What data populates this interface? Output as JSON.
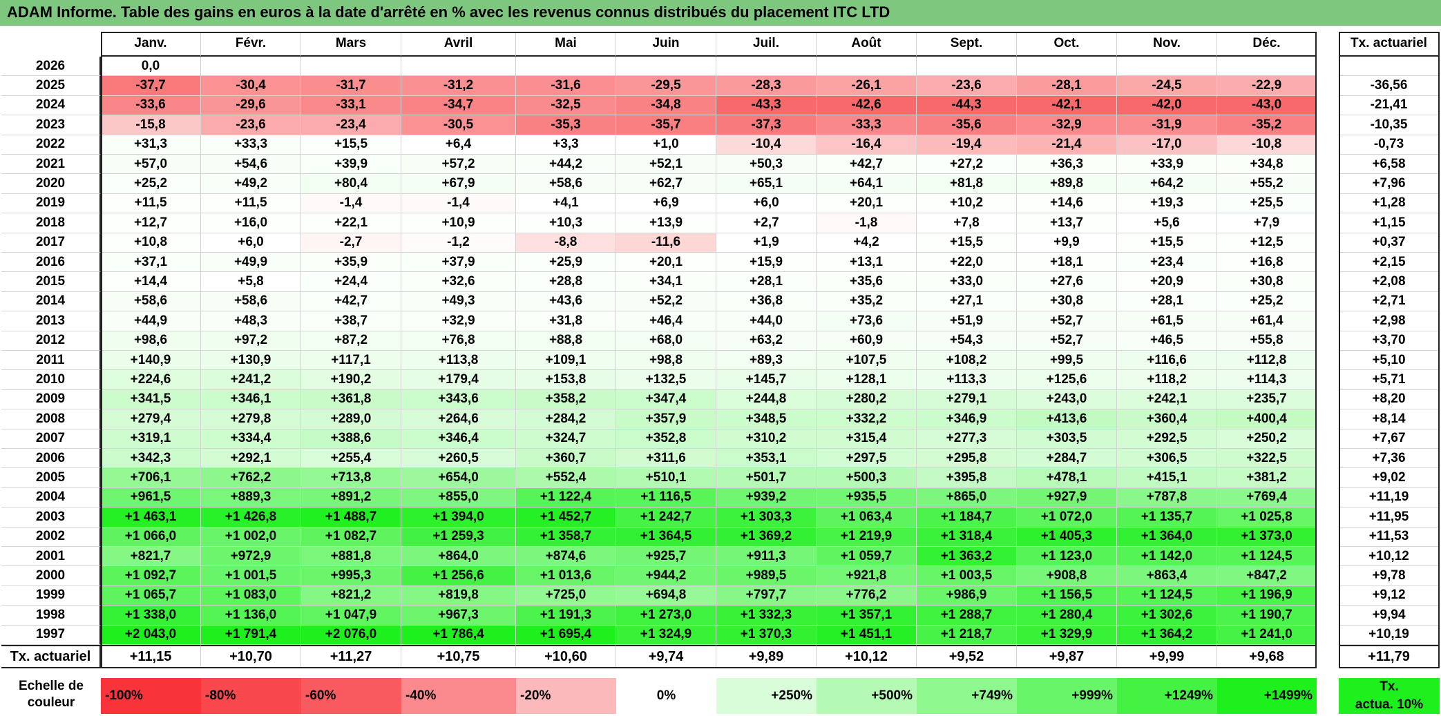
{
  "title": "ADAM Informe. Table des gains en euros à la date d'arrêté en % avec les revenus connus distribués du placement ITC LTD",
  "months": [
    "Janv.",
    "Févr.",
    "Mars",
    "Avril",
    "Mai",
    "Juin",
    "Juil.",
    "Août",
    "Sept.",
    "Oct.",
    "Nov.",
    "Déc."
  ],
  "rate_header": "Tx. actuariel",
  "rows": [
    {
      "year": "2026",
      "cells": [
        "0,0",
        "",
        "",
        "",
        "",
        "",
        "",
        "",
        "",
        "",
        "",
        ""
      ],
      "rate": ""
    },
    {
      "year": "2025",
      "cells": [
        "-37,7",
        "-30,4",
        "-31,7",
        "-31,2",
        "-31,6",
        "-29,5",
        "-28,3",
        "-26,1",
        "-23,6",
        "-28,1",
        "-24,5",
        "-22,9"
      ],
      "rate": "-36,56"
    },
    {
      "year": "2024",
      "cells": [
        "-33,6",
        "-29,6",
        "-33,1",
        "-34,7",
        "-32,5",
        "-34,8",
        "-43,3",
        "-42,6",
        "-44,3",
        "-42,1",
        "-42,0",
        "-43,0"
      ],
      "rate": "-21,41"
    },
    {
      "year": "2023",
      "cells": [
        "-15,8",
        "-23,6",
        "-23,4",
        "-30,5",
        "-35,3",
        "-35,7",
        "-37,3",
        "-33,3",
        "-35,6",
        "-32,9",
        "-31,9",
        "-35,2"
      ],
      "rate": "-10,35"
    },
    {
      "year": "2022",
      "cells": [
        "+31,3",
        "+33,3",
        "+15,5",
        "+6,4",
        "+3,3",
        "+1,0",
        "-10,4",
        "-16,4",
        "-19,4",
        "-21,4",
        "-17,0",
        "-10,8"
      ],
      "rate": "-0,73"
    },
    {
      "year": "2021",
      "cells": [
        "+57,0",
        "+54,6",
        "+39,9",
        "+57,2",
        "+44,2",
        "+52,1",
        "+50,3",
        "+42,7",
        "+27,2",
        "+36,3",
        "+33,9",
        "+34,8"
      ],
      "rate": "+6,58"
    },
    {
      "year": "2020",
      "cells": [
        "+25,2",
        "+49,2",
        "+80,4",
        "+67,9",
        "+58,6",
        "+62,7",
        "+65,1",
        "+64,1",
        "+81,8",
        "+89,8",
        "+64,2",
        "+55,2"
      ],
      "rate": "+7,96"
    },
    {
      "year": "2019",
      "cells": [
        "+11,5",
        "+11,5",
        "-1,4",
        "-1,4",
        "+4,1",
        "+6,9",
        "+6,0",
        "+20,1",
        "+10,2",
        "+14,6",
        "+19,3",
        "+25,5"
      ],
      "rate": "+1,28"
    },
    {
      "year": "2018",
      "cells": [
        "+12,7",
        "+16,0",
        "+22,1",
        "+10,9",
        "+10,3",
        "+13,9",
        "+2,7",
        "-1,8",
        "+7,8",
        "+13,7",
        "+5,6",
        "+7,9"
      ],
      "rate": "+1,15"
    },
    {
      "year": "2017",
      "cells": [
        "+10,8",
        "+6,0",
        "-2,7",
        "-1,2",
        "-8,8",
        "-11,6",
        "+1,9",
        "+4,2",
        "+15,5",
        "+9,9",
        "+15,5",
        "+12,5"
      ],
      "rate": "+0,37"
    },
    {
      "year": "2016",
      "cells": [
        "+37,1",
        "+49,9",
        "+35,9",
        "+37,9",
        "+25,9",
        "+20,1",
        "+15,9",
        "+13,1",
        "+22,0",
        "+18,1",
        "+23,4",
        "+16,8"
      ],
      "rate": "+2,15"
    },
    {
      "year": "2015",
      "cells": [
        "+14,4",
        "+5,8",
        "+24,4",
        "+32,6",
        "+28,8",
        "+34,1",
        "+28,1",
        "+35,6",
        "+33,0",
        "+27,6",
        "+20,9",
        "+30,8"
      ],
      "rate": "+2,08"
    },
    {
      "year": "2014",
      "cells": [
        "+58,6",
        "+58,6",
        "+42,7",
        "+49,3",
        "+43,6",
        "+52,2",
        "+36,8",
        "+35,2",
        "+27,1",
        "+30,8",
        "+28,1",
        "+25,2"
      ],
      "rate": "+2,71"
    },
    {
      "year": "2013",
      "cells": [
        "+44,9",
        "+48,3",
        "+38,7",
        "+32,9",
        "+31,8",
        "+46,4",
        "+44,0",
        "+73,6",
        "+51,9",
        "+52,7",
        "+61,5",
        "+61,4"
      ],
      "rate": "+2,98"
    },
    {
      "year": "2012",
      "cells": [
        "+98,6",
        "+97,2",
        "+87,2",
        "+76,8",
        "+88,8",
        "+68,0",
        "+63,2",
        "+60,9",
        "+54,3",
        "+52,7",
        "+46,5",
        "+55,8"
      ],
      "rate": "+3,70"
    },
    {
      "year": "2011",
      "cells": [
        "+140,9",
        "+130,9",
        "+117,1",
        "+113,8",
        "+109,1",
        "+98,8",
        "+89,3",
        "+107,5",
        "+108,2",
        "+99,5",
        "+116,6",
        "+112,8"
      ],
      "rate": "+5,10"
    },
    {
      "year": "2010",
      "cells": [
        "+224,6",
        "+241,2",
        "+190,2",
        "+179,4",
        "+153,8",
        "+132,5",
        "+145,7",
        "+128,1",
        "+113,3",
        "+125,6",
        "+118,2",
        "+114,3"
      ],
      "rate": "+5,71"
    },
    {
      "year": "2009",
      "cells": [
        "+341,5",
        "+346,1",
        "+361,8",
        "+343,6",
        "+358,2",
        "+347,4",
        "+244,8",
        "+280,2",
        "+279,1",
        "+243,0",
        "+242,1",
        "+235,7"
      ],
      "rate": "+8,20"
    },
    {
      "year": "2008",
      "cells": [
        "+279,4",
        "+279,8",
        "+289,0",
        "+264,6",
        "+284,2",
        "+357,9",
        "+348,5",
        "+332,2",
        "+346,9",
        "+413,6",
        "+360,4",
        "+400,4"
      ],
      "rate": "+8,14"
    },
    {
      "year": "2007",
      "cells": [
        "+319,1",
        "+334,4",
        "+388,6",
        "+346,4",
        "+324,7",
        "+352,8",
        "+310,2",
        "+315,4",
        "+277,3",
        "+303,5",
        "+292,5",
        "+250,2"
      ],
      "rate": "+7,67"
    },
    {
      "year": "2006",
      "cells": [
        "+342,3",
        "+292,1",
        "+255,4",
        "+260,5",
        "+360,7",
        "+311,6",
        "+353,1",
        "+297,5",
        "+295,8",
        "+284,7",
        "+306,5",
        "+322,5"
      ],
      "rate": "+7,36"
    },
    {
      "year": "2005",
      "cells": [
        "+706,1",
        "+762,2",
        "+713,8",
        "+654,0",
        "+552,4",
        "+510,1",
        "+501,7",
        "+500,3",
        "+395,8",
        "+478,1",
        "+415,1",
        "+381,2"
      ],
      "rate": "+9,02"
    },
    {
      "year": "2004",
      "cells": [
        "+961,5",
        "+889,3",
        "+891,2",
        "+855,0",
        "+1 122,4",
        "+1 116,5",
        "+939,2",
        "+935,5",
        "+865,0",
        "+927,9",
        "+787,8",
        "+769,4"
      ],
      "rate": "+11,19"
    },
    {
      "year": "2003",
      "cells": [
        "+1 463,1",
        "+1 426,8",
        "+1 488,7",
        "+1 394,0",
        "+1 452,7",
        "+1 242,7",
        "+1 303,3",
        "+1 063,4",
        "+1 184,7",
        "+1 072,0",
        "+1 135,7",
        "+1 025,8"
      ],
      "rate": "+11,95"
    },
    {
      "year": "2002",
      "cells": [
        "+1 066,0",
        "+1 002,0",
        "+1 082,7",
        "+1 259,3",
        "+1 358,7",
        "+1 364,5",
        "+1 369,2",
        "+1 219,9",
        "+1 318,4",
        "+1 405,3",
        "+1 364,0",
        "+1 373,0"
      ],
      "rate": "+11,53"
    },
    {
      "year": "2001",
      "cells": [
        "+821,7",
        "+972,9",
        "+881,8",
        "+864,0",
        "+874,6",
        "+925,7",
        "+911,3",
        "+1 059,7",
        "+1 363,2",
        "+1 123,0",
        "+1 142,0",
        "+1 124,5"
      ],
      "rate": "+10,12"
    },
    {
      "year": "2000",
      "cells": [
        "+1 092,7",
        "+1 001,5",
        "+995,3",
        "+1 256,6",
        "+1 013,6",
        "+944,2",
        "+989,5",
        "+921,8",
        "+1 003,5",
        "+908,8",
        "+863,4",
        "+847,2"
      ],
      "rate": "+9,78"
    },
    {
      "year": "1999",
      "cells": [
        "+1 065,7",
        "+1 083,0",
        "+821,2",
        "+819,8",
        "+725,0",
        "+694,8",
        "+797,7",
        "+776,2",
        "+986,9",
        "+1 156,5",
        "+1 124,5",
        "+1 196,9"
      ],
      "rate": "+9,12"
    },
    {
      "year": "1998",
      "cells": [
        "+1 338,0",
        "+1 136,0",
        "+1 047,9",
        "+967,3",
        "+1 191,3",
        "+1 273,0",
        "+1 332,3",
        "+1 357,1",
        "+1 288,7",
        "+1 280,4",
        "+1 302,6",
        "+1 190,7"
      ],
      "rate": "+9,94"
    },
    {
      "year": "1997",
      "cells": [
        "+2 043,0",
        "+1 791,4",
        "+2 076,0",
        "+1 786,4",
        "+1 695,4",
        "+1 324,9",
        "+1 370,3",
        "+1 451,1",
        "+1 218,7",
        "+1 329,9",
        "+1 364,2",
        "+1 241,0"
      ],
      "rate": "+10,19"
    }
  ],
  "totals": {
    "label": "Tx. actuariel",
    "cells": [
      "+11,15",
      "+10,70",
      "+11,27",
      "+10,75",
      "+10,60",
      "+9,74",
      "+9,89",
      "+10,12",
      "+9,52",
      "+9,87",
      "+9,99",
      "+9,68"
    ],
    "rate": "+11,79"
  },
  "legend": {
    "label_line1": "Echelle de",
    "label_line2": "couleur",
    "items": [
      {
        "text": "-100%",
        "color": "#f8333a",
        "align": "left"
      },
      {
        "text": "-80%",
        "color": "#f8474d",
        "align": "left"
      },
      {
        "text": "-60%",
        "color": "#f95a60",
        "align": "left"
      },
      {
        "text": "-40%",
        "color": "#fb8a8f",
        "align": "left"
      },
      {
        "text": "-20%",
        "color": "#fcb9bc",
        "align": "left"
      },
      {
        "text": "0%",
        "color": "#ffffff",
        "align": "center"
      },
      {
        "text": "+250%",
        "color": "#d9fdd9",
        "align": "right"
      },
      {
        "text": "+500%",
        "color": "#b4fab4",
        "align": "right"
      },
      {
        "text": "+749%",
        "color": "#8ef88e",
        "align": "right"
      },
      {
        "text": "+999%",
        "color": "#69f569",
        "align": "right"
      },
      {
        "text": "+1249%",
        "color": "#43f243",
        "align": "right"
      },
      {
        "text": "+1499%",
        "color": "#1ef01e",
        "align": "right"
      }
    ],
    "rate_line1": "Tx.",
    "rate_line2": "actua. 10%",
    "rate_color": "#1ef01e"
  },
  "colors": {
    "title_bg": "#7ec77e",
    "neg_max": "#f8696b",
    "pos_max": "#1ef01e",
    "neutral": "#ffffff"
  }
}
